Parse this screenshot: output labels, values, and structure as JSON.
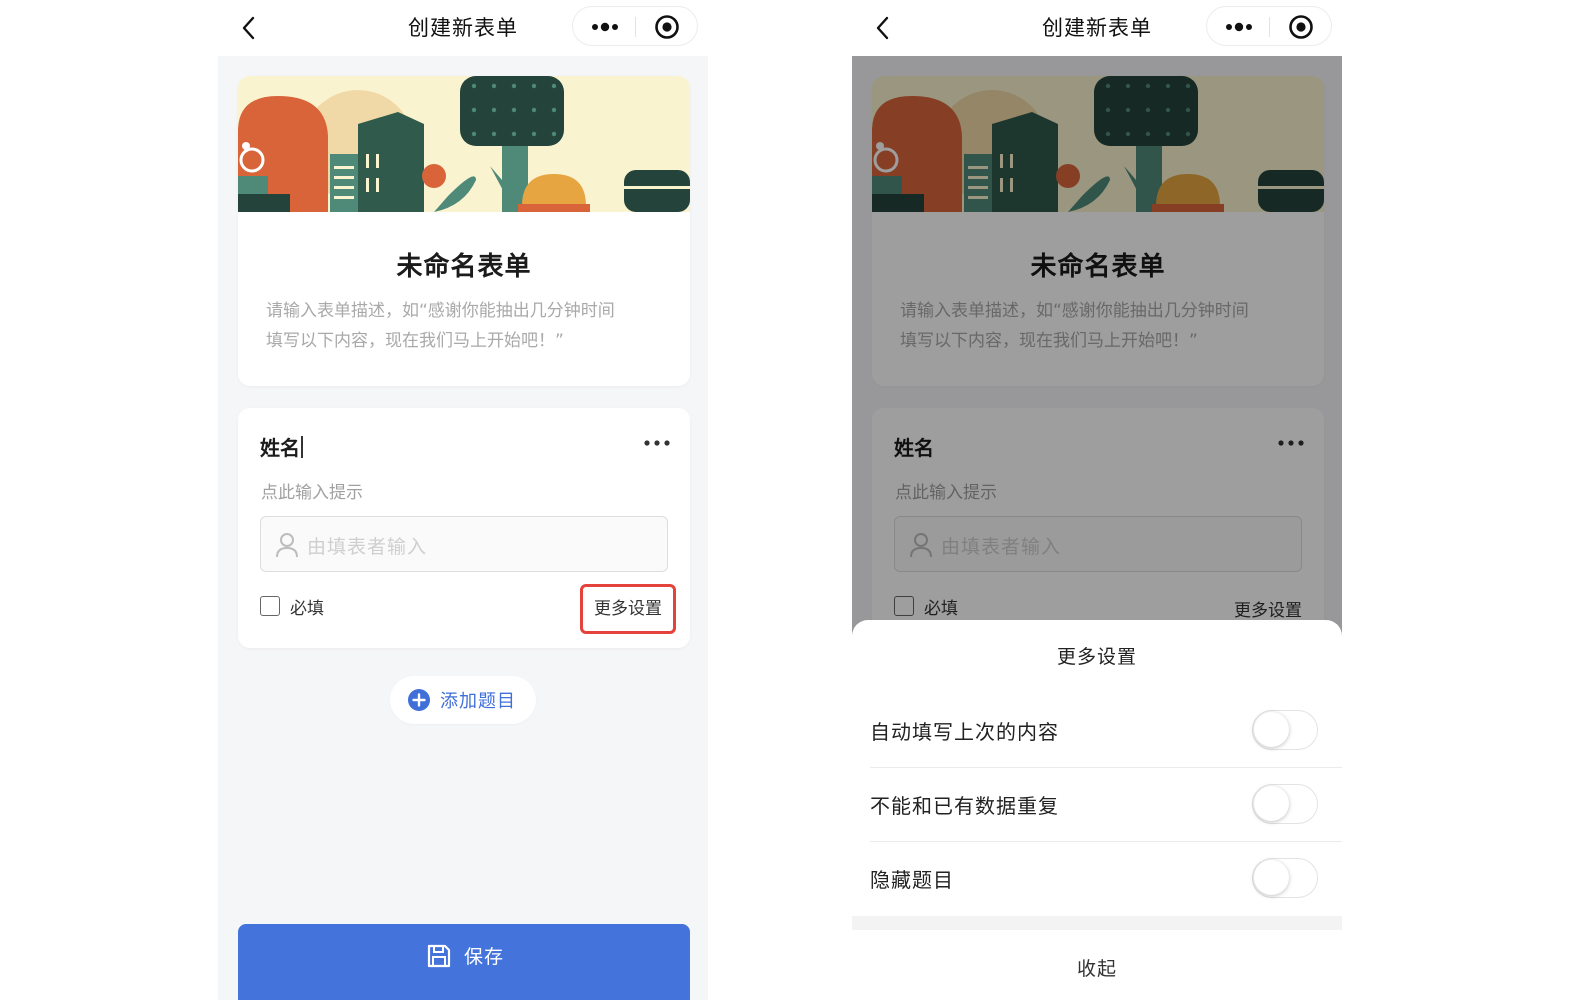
{
  "left_screen": {
    "navbar": {
      "title": "创建新表单"
    },
    "form": {
      "title": "未命名表单",
      "description_line1": "请输入表单描述，如“感谢你能抽出几分钟时间",
      "description_line2": "填写以下内容，现在我们马上开始吧！”"
    },
    "field": {
      "label": "姓名",
      "hint": "点此输入提示",
      "input_placeholder": "由填表者输入",
      "required_label": "必填",
      "required_checked": false,
      "more_settings": "更多设置",
      "highlight_color": "#e3433a"
    },
    "add_question": "添加题目",
    "save": "保存"
  },
  "right_screen": {
    "navbar": {
      "title": "创建新表单"
    },
    "form": {
      "title": "未命名表单",
      "description_line1": "请输入表单描述，如“感谢你能抽出几分钟时间",
      "description_line2": "填写以下内容，现在我们马上开始吧！”"
    },
    "field": {
      "label": "姓名",
      "hint": "点此输入提示",
      "input_placeholder": "由填表者输入",
      "required_label": "必填",
      "more_settings": "更多设置"
    },
    "sheet": {
      "title": "更多设置",
      "options": [
        {
          "label": "自动填写上次的内容",
          "on": false
        },
        {
          "label": "不能和已有数据重复",
          "on": false
        },
        {
          "label": "隐藏题目",
          "on": false
        }
      ],
      "collapse": "收起"
    }
  },
  "colors": {
    "accent_blue": "#4473db",
    "link_blue": "#3f6fd8",
    "page_bg": "#f5f6f8",
    "banner_bg": "#faf3cf",
    "banner_orange": "#d9643a",
    "banner_dark_green": "#24433a",
    "banner_teal": "#4f8a78"
  },
  "icons": [
    "back-icon",
    "more-dots-icon",
    "target-icon",
    "person-icon",
    "plus-circle-icon",
    "save-icon"
  ]
}
